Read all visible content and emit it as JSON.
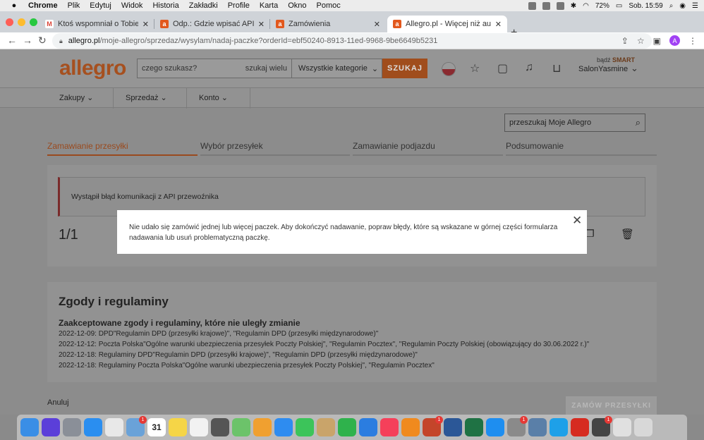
{
  "menubar": {
    "app": "Chrome",
    "items": [
      "Plik",
      "Edytuj",
      "Widok",
      "Historia",
      "Zakładki",
      "Profile",
      "Karta",
      "Okno",
      "Pomoc"
    ],
    "battery": "72%",
    "clock": "Sob. 15:59"
  },
  "tabs": [
    {
      "title": "Ktoś wspomniał o Tobie w Spo",
      "favicon": "M",
      "color": "#db4437"
    },
    {
      "title": "Odp.: Gdzie wpisać API InPost",
      "favicon": "a",
      "color": "#e2581d"
    },
    {
      "title": "Zamówienia",
      "favicon": "a",
      "color": "#e2581d"
    },
    {
      "title": "Allegro.pl - Więcej niż aukcje.",
      "favicon": "a",
      "color": "#e2581d"
    }
  ],
  "address": {
    "host": "allegro.pl",
    "path": "/moje-allegro/sprzedaz/wysylam/nadaj-paczke?orderId=ebf50240-8913-11ed-9968-9be6649b5231",
    "profile_initial": "A"
  },
  "header": {
    "logo": "allegro",
    "search_placeholder": "czego szukasz?",
    "search_many": "szukaj wielu",
    "category": "Wszystkie kategorie",
    "search_button": "SZUKAJ",
    "smart_prefix": "bądź",
    "smart": "SMART",
    "username": "SalonYasmine"
  },
  "catnav": [
    "Zakupy",
    "Sprzedaż",
    "Konto"
  ],
  "my_allegro_search": "przeszukaj Moje Allegro",
  "steps": [
    "Zamawianie przesyłki",
    "Wybór przesyłek",
    "Zamawianie podjazdu",
    "Podsumowanie"
  ],
  "error_banner": "Wystąpił błąd komunikacji z API przewoźnika",
  "counter": "1/1",
  "consents": {
    "title": "Zgody i regulaminy",
    "subtitle": "Zaakceptowane zgody i regulaminy, które nie uległy zmianie",
    "rows": [
      "2022-12-09: DPD\"Regulamin DPD (przesyłki krajowe)\", \"Regulamin DPD (przesyłki międzynarodowe)\"",
      "2022-12-12: Poczta Polska\"Ogólne warunki ubezpieczenia przesyłek Poczty Polskiej\", \"Regulamin Pocztex\", \"Regulamin Poczty Polskiej (obowiązujący do 30.06.2022 r.)\"",
      "2022-12-18: Regulaminy DPD\"Regulamin DPD (przesyłki krajowe)\", \"Regulamin DPD (przesyłki międzynarodowe)\"",
      "2022-12-18: Regulaminy Poczta Polska\"Ogólne warunki ubezpieczenia przesyłek Poczty Polskiej\", \"Regulamin Pocztex\""
    ]
  },
  "footer": {
    "cancel": "Anuluj",
    "order_button": "ZAMÓW PRZESYŁKI"
  },
  "modal": {
    "message": "Nie udało się zamówić jednej lub więcej paczek. Aby dokończyć nadawanie, popraw błędy, które są wskazane w górnej części formularza nadawania lub usuń problematyczną paczkę."
  },
  "dock": {
    "calendar_day": "31",
    "apps": [
      {
        "name": "finder",
        "color": "#3a8ee6"
      },
      {
        "name": "siri",
        "color": "#5b3fd9"
      },
      {
        "name": "launchpad",
        "color": "#8a8f98"
      },
      {
        "name": "safari",
        "color": "#2a8ef0"
      },
      {
        "name": "chrome",
        "color": "#e8e8e8"
      },
      {
        "name": "preview",
        "color": "#6aa2d8",
        "badge": "1"
      },
      {
        "name": "calendar",
        "color": "#ffffff"
      },
      {
        "name": "notes",
        "color": "#f5d547"
      },
      {
        "name": "reminders",
        "color": "#f2f2f2"
      },
      {
        "name": "calculator",
        "color": "#555555"
      },
      {
        "name": "maps",
        "color": "#6cc36a"
      },
      {
        "name": "photos",
        "color": "#f0a030"
      },
      {
        "name": "messenger",
        "color": "#2e8cf0"
      },
      {
        "name": "facetime",
        "color": "#3cc45a"
      },
      {
        "name": "contacts",
        "color": "#c9a46a"
      },
      {
        "name": "numbers",
        "color": "#2fb24c"
      },
      {
        "name": "keynote",
        "color": "#2b7de0"
      },
      {
        "name": "music",
        "color": "#f5405a"
      },
      {
        "name": "books",
        "color": "#f08a1e"
      },
      {
        "name": "powerpoint",
        "color": "#c4452a",
        "badge": "1"
      },
      {
        "name": "word",
        "color": "#2b5797"
      },
      {
        "name": "excel",
        "color": "#1f7244"
      },
      {
        "name": "app-store",
        "color": "#1e8ef0"
      },
      {
        "name": "system-preferences",
        "color": "#8a8a8a",
        "badge": "1"
      },
      {
        "name": "image-capture",
        "color": "#5a7fa8"
      },
      {
        "name": "skype",
        "color": "#1ea0e8"
      },
      {
        "name": "acrobat",
        "color": "#d62b20"
      },
      {
        "name": "printer",
        "color": "#444444",
        "badge": "1"
      },
      {
        "name": "downloads",
        "color": "#e0e0e0"
      },
      {
        "name": "trash",
        "color": "#d8d8d8"
      }
    ]
  }
}
